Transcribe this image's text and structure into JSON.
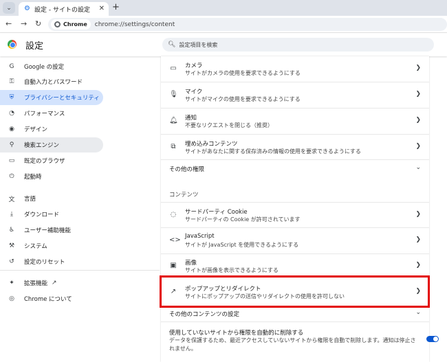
{
  "tab": {
    "title": "設定 - サイトの設定",
    "close": "✕",
    "new_tab": "+",
    "menu": "⌄"
  },
  "toolbar": {
    "back": "←",
    "forward": "→",
    "reload": "↻",
    "chip_label": "Chrome",
    "url": "chrome://settings/content"
  },
  "header": {
    "title": "設定",
    "search_placeholder": "設定項目を検索"
  },
  "sidebar": {
    "items": [
      {
        "label": "Google の設定",
        "icon": "G"
      },
      {
        "label": "自動入力とパスワード",
        "icon": "⚿"
      },
      {
        "label": "プライバシーとセキュリティ",
        "icon": "⛨"
      },
      {
        "label": "パフォーマンス",
        "icon": "◔"
      },
      {
        "label": "デザイン",
        "icon": "◉"
      },
      {
        "label": "検索エンジン",
        "icon": "⚲"
      },
      {
        "label": "既定のブラウザ",
        "icon": "▭"
      },
      {
        "label": "起動時",
        "icon": "⏻"
      },
      {
        "label": "言語",
        "icon": "文"
      },
      {
        "label": "ダウンロード",
        "icon": "⤓"
      },
      {
        "label": "ユーザー補助機能",
        "icon": "♿"
      },
      {
        "label": "システム",
        "icon": "⚒"
      },
      {
        "label": "設定のリセット",
        "icon": "↺"
      },
      {
        "label": "拡張機能",
        "icon": "✦"
      },
      {
        "label": "Chrome について",
        "icon": "◎"
      }
    ],
    "ext_link": "↗"
  },
  "main": {
    "camera": {
      "title": "カメラ",
      "sub": "サイトがカメラの使用を要求できるようにする"
    },
    "mic": {
      "title": "マイク",
      "sub": "サイトがマイクの使用を要求できるようにする"
    },
    "notifications": {
      "title": "通知",
      "sub": "不要なリクエストを閉じる（推奨）"
    },
    "embedded": {
      "title": "埋め込みコンテンツ",
      "sub": "サイトがあなたに関する保存済みの情報の使用を要求できるようにする"
    },
    "more_permissions": "その他の権限",
    "content_heading": "コンテンツ",
    "third_party_cookie": {
      "title": "サードパーティ Cookie",
      "sub": "サードパーティの Cookie が許可されています"
    },
    "javascript": {
      "title": "JavaScript",
      "sub": "サイトが JavaScript を使用できるようにする"
    },
    "images": {
      "title": "画像",
      "sub": "サイトが画像を表示できるようにする"
    },
    "popups": {
      "title": "ポップアップとリダイレクト",
      "sub": "サイトにポップアップの送信やリダイレクトの使用を許可しない"
    },
    "more_content": "その他のコンテンツの設定",
    "auto_revoke": {
      "title": "使用していないサイトから権限を自動的に削除する",
      "sub1": "データを保護するため、最近アクセスしていないサイトから権限を自動で削除します。通知は停止さ",
      "sub2": "れません。",
      "enabled": true
    }
  },
  "colors": {
    "accent": "#0b57d0",
    "active_bg": "#d3e3fd",
    "highlight": "#e30000"
  }
}
